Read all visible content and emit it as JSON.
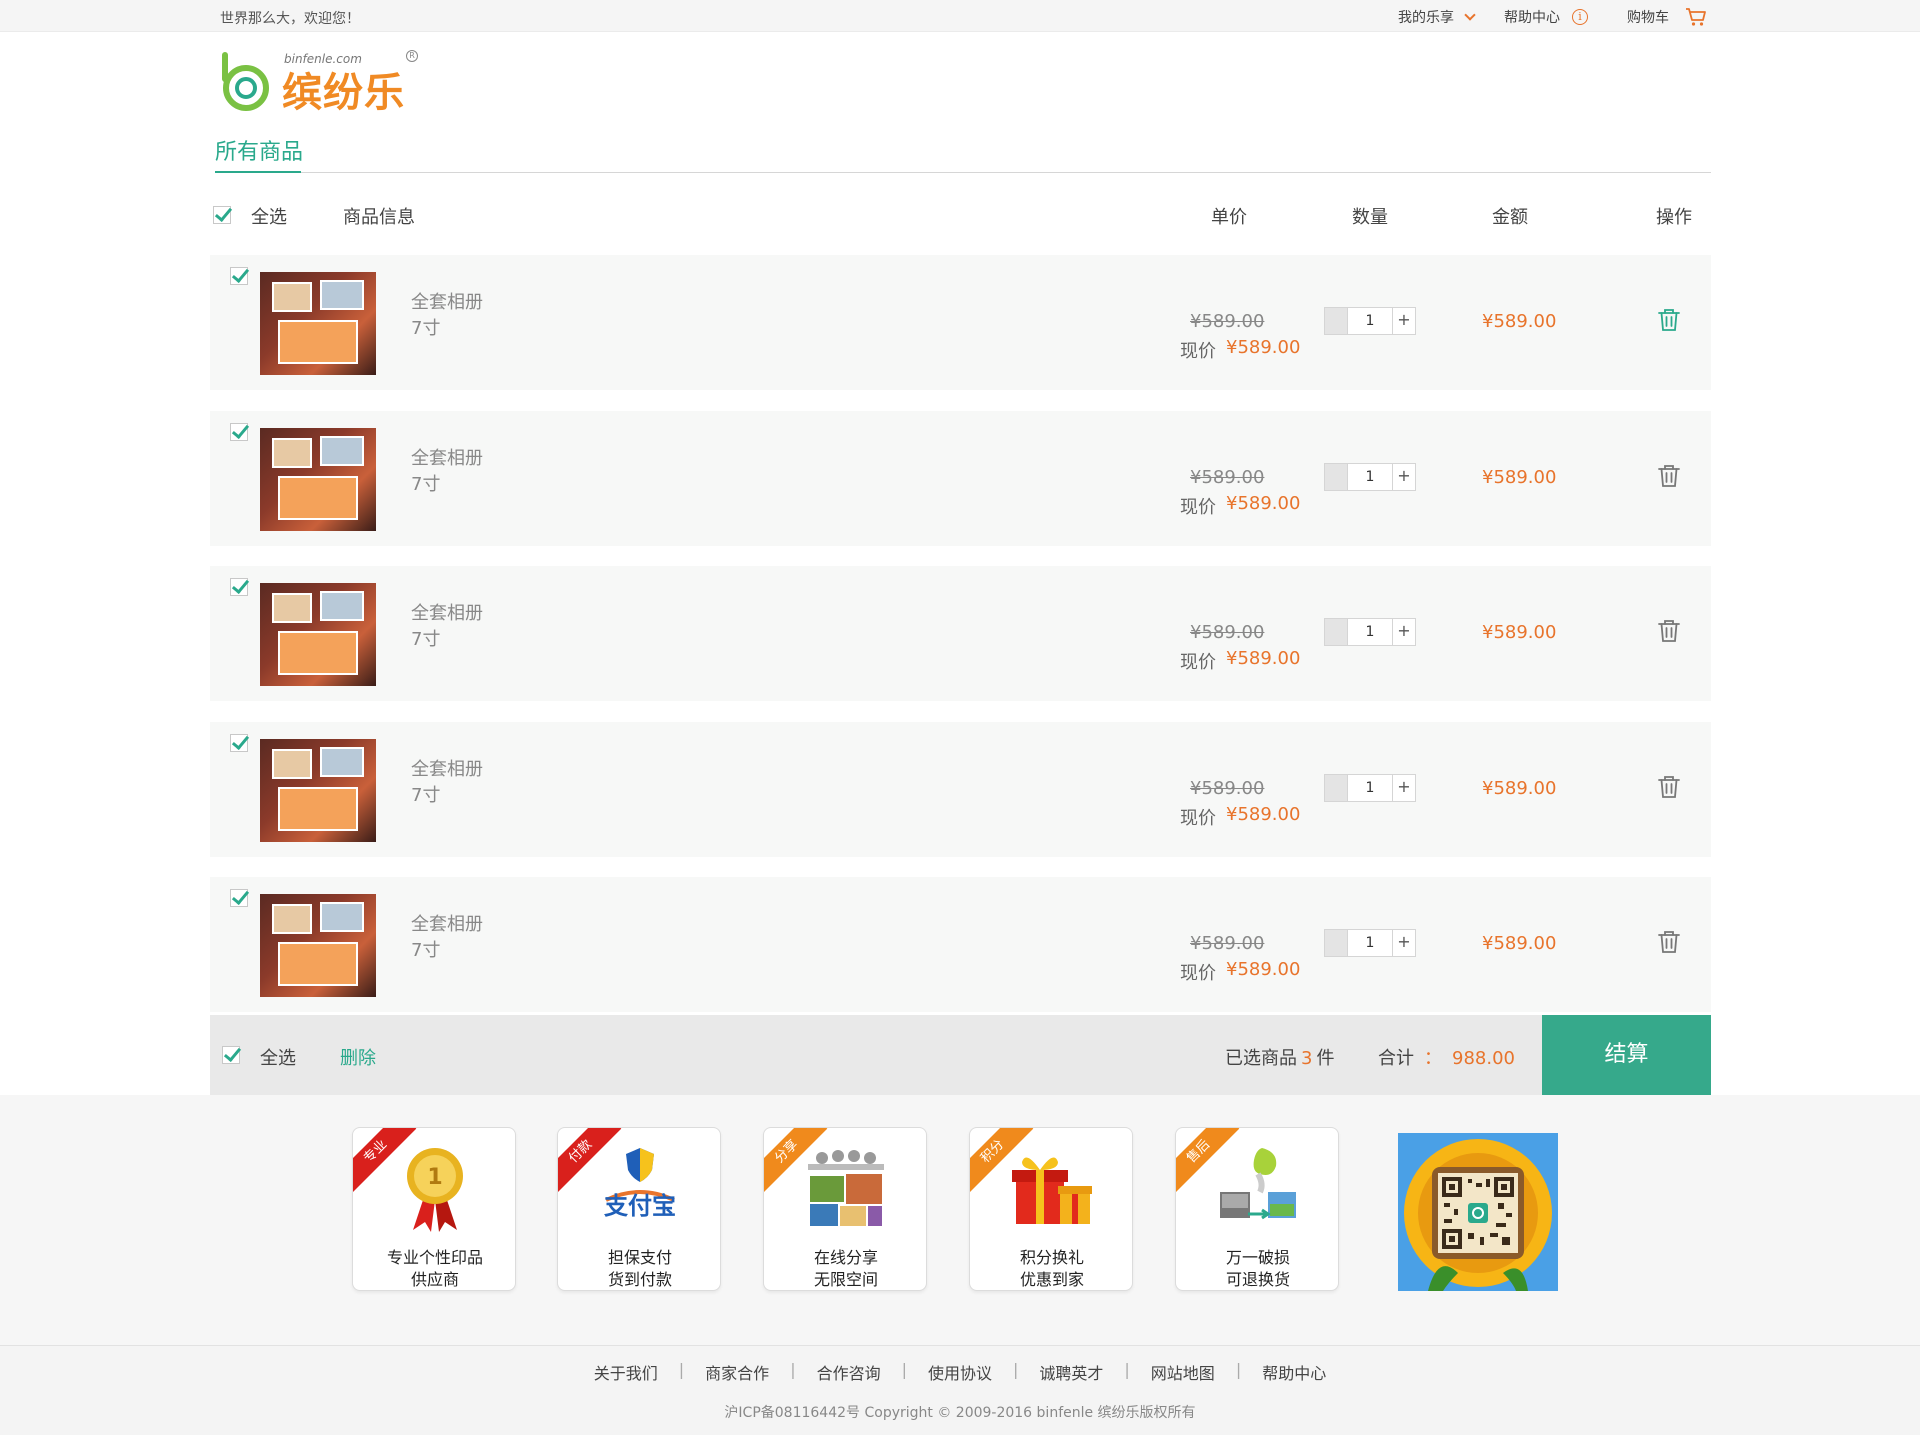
{
  "topbar": {
    "welcome": "世界那么大，欢迎您！",
    "my_le": "我的乐享",
    "help": "帮助中心",
    "cart": "购物车"
  },
  "logo": {
    "brand": "缤纷乐",
    "domain": "binfenle.com",
    "reg": "R"
  },
  "tab": {
    "label": "所有商品"
  },
  "table_header": {
    "select_all": "全选",
    "info": "商品信息",
    "unit_price": "单价",
    "qty": "数量",
    "amount": "金额",
    "ops": "操作"
  },
  "items": [
    {
      "name": "全套相册",
      "spec": "7寸",
      "old_price": "¥589.00",
      "now_label": "现价",
      "now_price": "¥589.00",
      "qty": "1",
      "minus": "",
      "plus": "+",
      "amount": "¥589.00",
      "trash_color": "#2aa98c"
    },
    {
      "name": "全套相册",
      "spec": "7寸",
      "old_price": "¥589.00",
      "now_label": "现价",
      "now_price": "¥589.00",
      "qty": "1",
      "minus": "",
      "plus": "+",
      "amount": "¥589.00",
      "trash_color": "#777777"
    },
    {
      "name": "全套相册",
      "spec": "7寸",
      "old_price": "¥589.00",
      "now_label": "现价",
      "now_price": "¥589.00",
      "qty": "1",
      "minus": "",
      "plus": "+",
      "amount": "¥589.00",
      "trash_color": "#777777"
    },
    {
      "name": "全套相册",
      "spec": "7寸",
      "old_price": "¥589.00",
      "now_label": "现价",
      "now_price": "¥589.00",
      "qty": "1",
      "minus": "",
      "plus": "+",
      "amount": "¥589.00",
      "trash_color": "#777777"
    },
    {
      "name": "全套相册",
      "spec": "7寸",
      "old_price": "¥589.00",
      "now_label": "现价",
      "now_price": "¥589.00",
      "qty": "1",
      "minus": "",
      "plus": "+",
      "amount": "¥589.00",
      "trash_color": "#777777"
    }
  ],
  "bottombar": {
    "select_all": "全选",
    "delete": "删除",
    "selected_prefix": "已选商品",
    "selected_count": "3",
    "selected_suffix": "件",
    "total_label": "合计",
    "total_colon": "：",
    "total_value": "988.00",
    "checkout": "结算"
  },
  "features": [
    {
      "ribbon": "专业",
      "ribbon_color": "red",
      "line1": "专业个性印品",
      "line2": "供应商",
      "icon": "medal-icon"
    },
    {
      "ribbon": "付款",
      "ribbon_color": "red",
      "line1": "担保支付",
      "line2": "货到付款",
      "icon": "alipay-icon"
    },
    {
      "ribbon": "分享",
      "ribbon_color": "orange",
      "line1": "在线分享",
      "line2": "无限空间",
      "icon": "share-photos-icon"
    },
    {
      "ribbon": "积分",
      "ribbon_color": "orange",
      "line1": "积分换礼",
      "line2": "优惠到家",
      "icon": "gift-icon"
    },
    {
      "ribbon": "售后",
      "ribbon_color": "orange",
      "line1": "万一破损",
      "line2": "可退换货",
      "icon": "return-icon"
    }
  ],
  "footer": {
    "links": [
      "关于我们",
      "商家合作",
      "合作咨询",
      "使用协议",
      "诚聘英才",
      "网站地图",
      "帮助中心"
    ],
    "separator": "|",
    "copyright": "沪ICP备08116442号 Copyright © 2009-2016 binfenle 缤纷乐版权所有"
  },
  "colors": {
    "accent": "#2aa98c",
    "price": "#e8742c",
    "checkout_bg": "#36a98b"
  }
}
